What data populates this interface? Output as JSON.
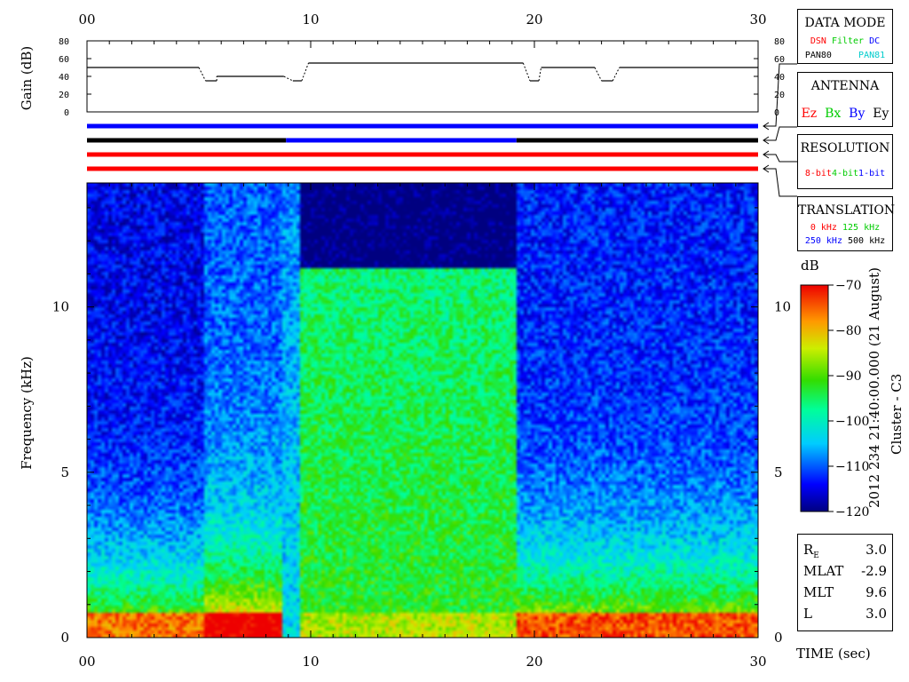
{
  "chart_data": {
    "type": "heatmap",
    "xlabel": "TIME (sec)",
    "ylabel": "Frequency (kHz)",
    "x_range": [
      0,
      30
    ],
    "y_range": [
      0,
      13.75
    ],
    "x_ticks": [
      "00",
      "10",
      "20",
      "30"
    ],
    "y_ticks": [
      "0",
      "5",
      "10"
    ],
    "colorbar": {
      "unit": "dB",
      "range": [
        -120,
        -70
      ],
      "ticks": [
        "-70",
        "-80",
        "-90",
        "-100",
        "-110",
        "-120"
      ]
    },
    "side_label": "2012 234 21:40:00.000 (21 August)",
    "spacecraft": "Cluster - C3",
    "gain_panel": {
      "ylabel": "Gain (dB)",
      "range": [
        0,
        80
      ],
      "ticks": [
        "80",
        "60",
        "40",
        "20",
        "0"
      ],
      "segments": [
        {
          "t0": 0.0,
          "t1": 5.0,
          "gain": 50
        },
        {
          "t0": 5.3,
          "t1": 5.8,
          "gain": 35
        },
        {
          "t0": 5.8,
          "t1": 8.8,
          "gain": 40
        },
        {
          "t0": 9.2,
          "t1": 9.6,
          "gain": 35
        },
        {
          "t0": 9.9,
          "t1": 19.5,
          "gain": 55
        },
        {
          "t0": 19.8,
          "t1": 20.2,
          "gain": 35
        },
        {
          "t0": 20.3,
          "t1": 22.7,
          "gain": 50
        },
        {
          "t0": 23.0,
          "t1": 23.5,
          "gain": 35
        },
        {
          "t0": 23.8,
          "t1": 30.0,
          "gain": 50
        }
      ]
    },
    "status_bars": {
      "data_mode": [
        {
          "t0": 0,
          "t1": 30,
          "value": "DC"
        }
      ],
      "antenna": [
        {
          "t0": 0,
          "t1": 8.9,
          "value": "Ey"
        },
        {
          "t0": 8.9,
          "t1": 19.2,
          "value": "By"
        },
        {
          "t0": 19.2,
          "t1": 30,
          "value": "Ey"
        }
      ],
      "resolution": [
        {
          "t0": 0,
          "t1": 30,
          "value": "8-bit"
        }
      ],
      "translation": [
        {
          "t0": 0,
          "t1": 30,
          "value": "0 kHz"
        }
      ]
    },
    "spectrogram_regions": [
      {
        "t0": 0.0,
        "t1": 5.2,
        "description": "quiet background with low-frequency enhancement",
        "level_low_freq": -80,
        "level_high_freq": -115
      },
      {
        "t0": 5.2,
        "t1": 8.8,
        "description": "broadband emission with dispersed feature",
        "level_low_freq": -72,
        "level_high_freq": -110
      },
      {
        "t0": 8.8,
        "t1": 9.6,
        "description": "gain switch transition",
        "level_low_freq": -100,
        "level_high_freq": -105
      },
      {
        "t0": 9.6,
        "t1": 19.2,
        "description": "enhanced broadband noise up to 11 kHz",
        "level_low_freq": -92,
        "level_high_freq": -120
      },
      {
        "t0": 19.2,
        "t1": 30.0,
        "description": "background with low-frequency enhancement",
        "level_low_freq": -78,
        "level_high_freq": -113
      }
    ]
  },
  "legend": {
    "data_mode": {
      "title": "DATA MODE",
      "labels": [
        "DSN",
        "Filter",
        "DC",
        "PAN80",
        "PAN81"
      ]
    },
    "antenna": {
      "title": "ANTENNA",
      "labels": [
        "Ez",
        "Bx",
        "By",
        "Ey"
      ]
    },
    "resolution": {
      "title": "RESOLUTION",
      "labels": [
        "8-bit",
        "4-bit",
        "1-bit"
      ]
    },
    "translation": {
      "title": "TRANSLATION",
      "labels": [
        "0 kHz",
        "125 kHz",
        "250 kHz",
        "500 kHz"
      ]
    }
  },
  "position": [
    {
      "key": "R",
      "sub": "E",
      "value": "3.0"
    },
    {
      "key": "MLAT",
      "sub": "",
      "value": "-2.9"
    },
    {
      "key": "MLT",
      "sub": "",
      "value": "9.6"
    },
    {
      "key": "L",
      "sub": "",
      "value": "3.0"
    }
  ],
  "colors": {
    "red": "#ff0000",
    "green": "#00cc00",
    "blue": "#0000ff",
    "cyan": "#00cccc",
    "black": "#000000",
    "spectrogram_bg": "#05105a"
  }
}
